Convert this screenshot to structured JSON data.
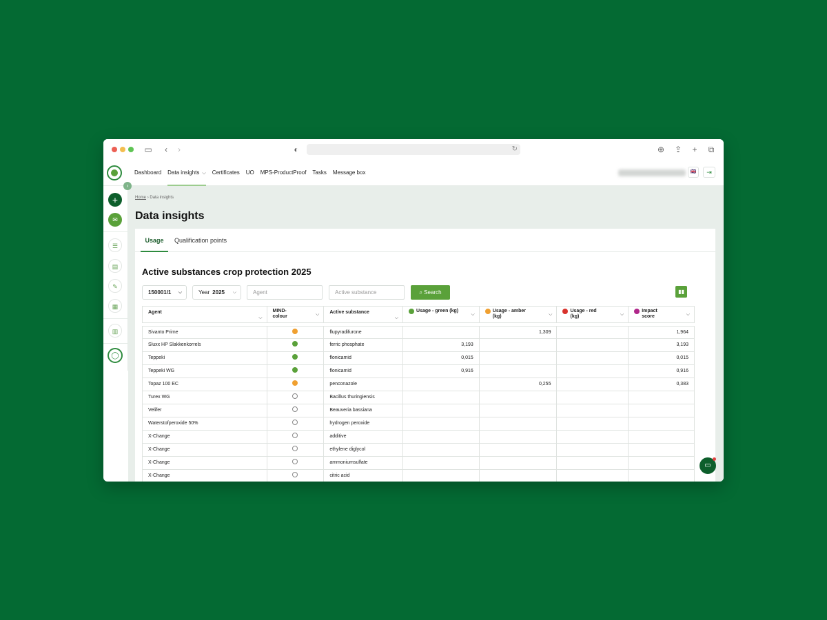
{
  "nav": {
    "items": [
      "Dashboard",
      "Data insights",
      "Certificates",
      "UO",
      "MPS-ProductProof",
      "Tasks",
      "Message box"
    ],
    "active_index": 1,
    "language_flag": "🇬🇧"
  },
  "breadcrumb": {
    "home": "Home",
    "current": "Data insights"
  },
  "page": {
    "title": "Data insights"
  },
  "tabs": {
    "usage": "Usage",
    "qualification": "Qualification points"
  },
  "section": {
    "title": "Active substances crop protection 2025"
  },
  "filters": {
    "relation": "150001/1",
    "year_label": "Year",
    "year_value": "2025",
    "agent_placeholder": "Agent",
    "substance_placeholder": "Active substance",
    "search_label": "Search"
  },
  "colors": {
    "green": "#5aa13a",
    "amber": "#f0a030",
    "red": "#d8322c",
    "impact": "#b0278a",
    "brand": "#0d5e2b"
  },
  "table": {
    "headers": {
      "agent": "Agent",
      "mind": "MIND-colour",
      "substance": "Active substance",
      "green": "Usage - green (kg)",
      "amber": "Usage - amber (kg)",
      "red": "Usage - red (kg)",
      "impact": "Impact score"
    },
    "rows": [
      {
        "agent": "Sivanto Prime",
        "mind": "amber",
        "substance": "flupyradifurone",
        "green": "",
        "amber": "1,309",
        "red": "",
        "impact": "1,964"
      },
      {
        "agent": "Sluxx HP Slakkenkorrels",
        "mind": "green",
        "substance": "ferric phosphate",
        "green": "3,193",
        "amber": "",
        "red": "",
        "impact": "3,193"
      },
      {
        "agent": "Teppeki",
        "mind": "green",
        "substance": "flonicamid",
        "green": "0,015",
        "amber": "",
        "red": "",
        "impact": "0,015"
      },
      {
        "agent": "Teppeki WG",
        "mind": "green",
        "substance": "flonicamid",
        "green": "0,916",
        "amber": "",
        "red": "",
        "impact": "0,916"
      },
      {
        "agent": "Topaz 100 EC",
        "mind": "amber",
        "substance": "penconazole",
        "green": "",
        "amber": "0,255",
        "red": "",
        "impact": "0,383"
      },
      {
        "agent": "Turex WG",
        "mind": "none",
        "substance": "Bacillus thuringiensis",
        "green": "",
        "amber": "",
        "red": "",
        "impact": ""
      },
      {
        "agent": "Velifer",
        "mind": "none",
        "substance": "Beauveria bassiana",
        "green": "",
        "amber": "",
        "red": "",
        "impact": ""
      },
      {
        "agent": "Waterstofperoxide 50%",
        "mind": "none",
        "substance": "hydrogen peroxide",
        "green": "",
        "amber": "",
        "red": "",
        "impact": ""
      },
      {
        "agent": "X-Change",
        "mind": "none",
        "substance": "additive",
        "green": "",
        "amber": "",
        "red": "",
        "impact": ""
      },
      {
        "agent": "X-Change",
        "mind": "none",
        "substance": "ethylene diglycol",
        "green": "",
        "amber": "",
        "red": "",
        "impact": ""
      },
      {
        "agent": "X-Change",
        "mind": "none",
        "substance": "ammoniumsulfate",
        "green": "",
        "amber": "",
        "red": "",
        "impact": ""
      },
      {
        "agent": "X-Change",
        "mind": "none",
        "substance": "citric acid",
        "green": "",
        "amber": "",
        "red": "",
        "impact": ""
      }
    ]
  }
}
